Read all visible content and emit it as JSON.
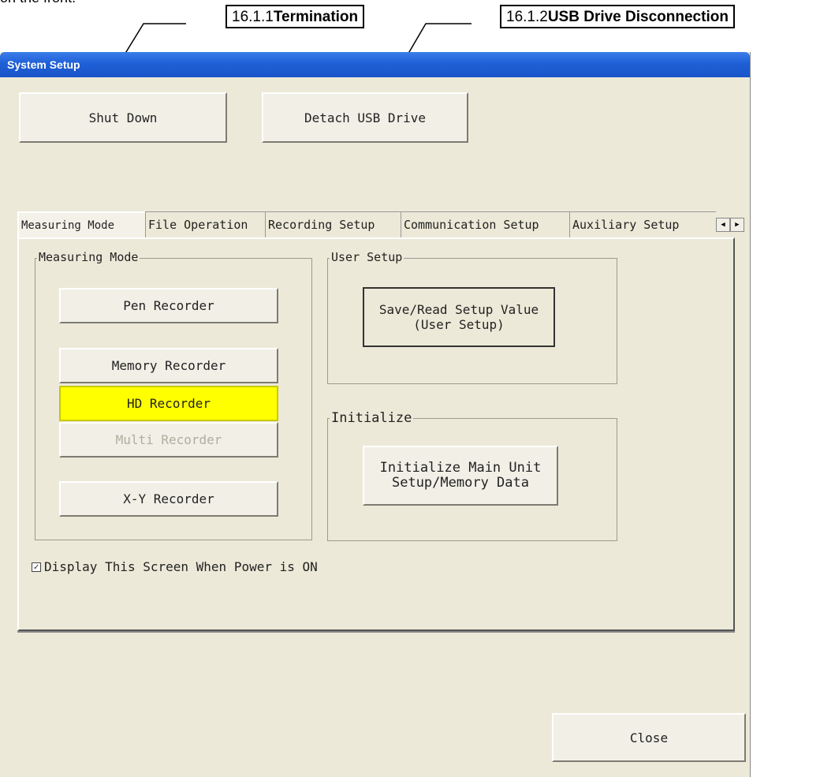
{
  "document": {
    "top_text": "on the front.",
    "callouts": [
      {
        "number": "16.1.1",
        "title": "Termination"
      },
      {
        "number": "16.1.2",
        "title": "USB Drive Disconnection"
      }
    ]
  },
  "window": {
    "title": "System Setup",
    "shutdown_label": "Shut Down",
    "detach_usb_label": "Detach USB Drive",
    "close_label": "Close"
  },
  "tabs": [
    {
      "label": "Measuring Mode",
      "active": true
    },
    {
      "label": "File Operation",
      "active": false
    },
    {
      "label": "Recording Setup",
      "active": false
    },
    {
      "label": "Communication Setup",
      "active": false
    },
    {
      "label": "Auxiliary Setup",
      "active": false
    }
  ],
  "measuring_mode": {
    "group_label": "Measuring Mode",
    "pen": "Pen Recorder",
    "memory": "Memory Recorder",
    "hd": "HD Recorder",
    "multi": "Multi Recorder",
    "xy": "X-Y Recorder",
    "selected": "HD Recorder"
  },
  "user_setup": {
    "group_label": "User Setup",
    "button_label": "Save/Read Setup Value\n(User Setup)"
  },
  "initialize": {
    "group_label": "Initialize",
    "button_label": "Initialize Main Unit\nSetup/Memory Data"
  },
  "display_on_power": {
    "label": "Display This Screen When Power is ON",
    "checked": true
  },
  "colors": {
    "selected_highlight": "#ffff00",
    "titlebar": "#1f5fd6",
    "window_bg": "#ece9d8"
  }
}
